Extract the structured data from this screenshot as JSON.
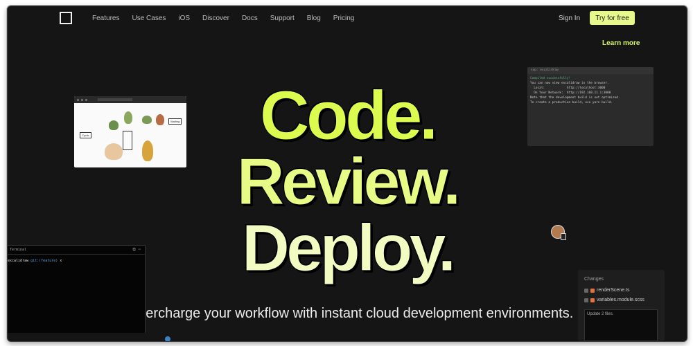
{
  "nav": {
    "links": [
      "Features",
      "Use Cases",
      "iOS",
      "Discover",
      "Docs",
      "Support",
      "Blog",
      "Pricing"
    ],
    "sign_in": "Sign In",
    "try_free": "Try for free",
    "learn_more": "Learn more"
  },
  "hero": {
    "line1": "Code.",
    "line2": "Review.",
    "line3": "Deploy.",
    "subtitle": "Supercharge your workflow with instant cloud development environments."
  },
  "code_panel": {
    "header": "sup: excalidraw",
    "lines": [
      "Compiled successfully!",
      "",
      "You can now view excalidraw in the browser.",
      "",
      "  Local:            http://localhost:3000",
      "  On Your Network:  http://192.168.11.1:3000",
      "",
      "Note that the development build is not optimized.",
      "To create a production build, use yarn build."
    ]
  },
  "terminal": {
    "title": "Terminal",
    "prompt": "excalidraw",
    "branch": "git:(feature)",
    "cursor": "x"
  },
  "whiteboard": {
    "label_left": "Cyclic",
    "label_right": "Waiting"
  },
  "changes": {
    "title": "Changes",
    "files": [
      "renderScene.ts",
      "variables.module.scss"
    ],
    "commit_text": "Update 2 files."
  },
  "colors": {
    "accent": "#e7f98a",
    "hero_line1": "#dcfb4f",
    "hero_line2": "#e9fb87",
    "hero_line3": "#f2fbc2",
    "background": "#151515"
  }
}
